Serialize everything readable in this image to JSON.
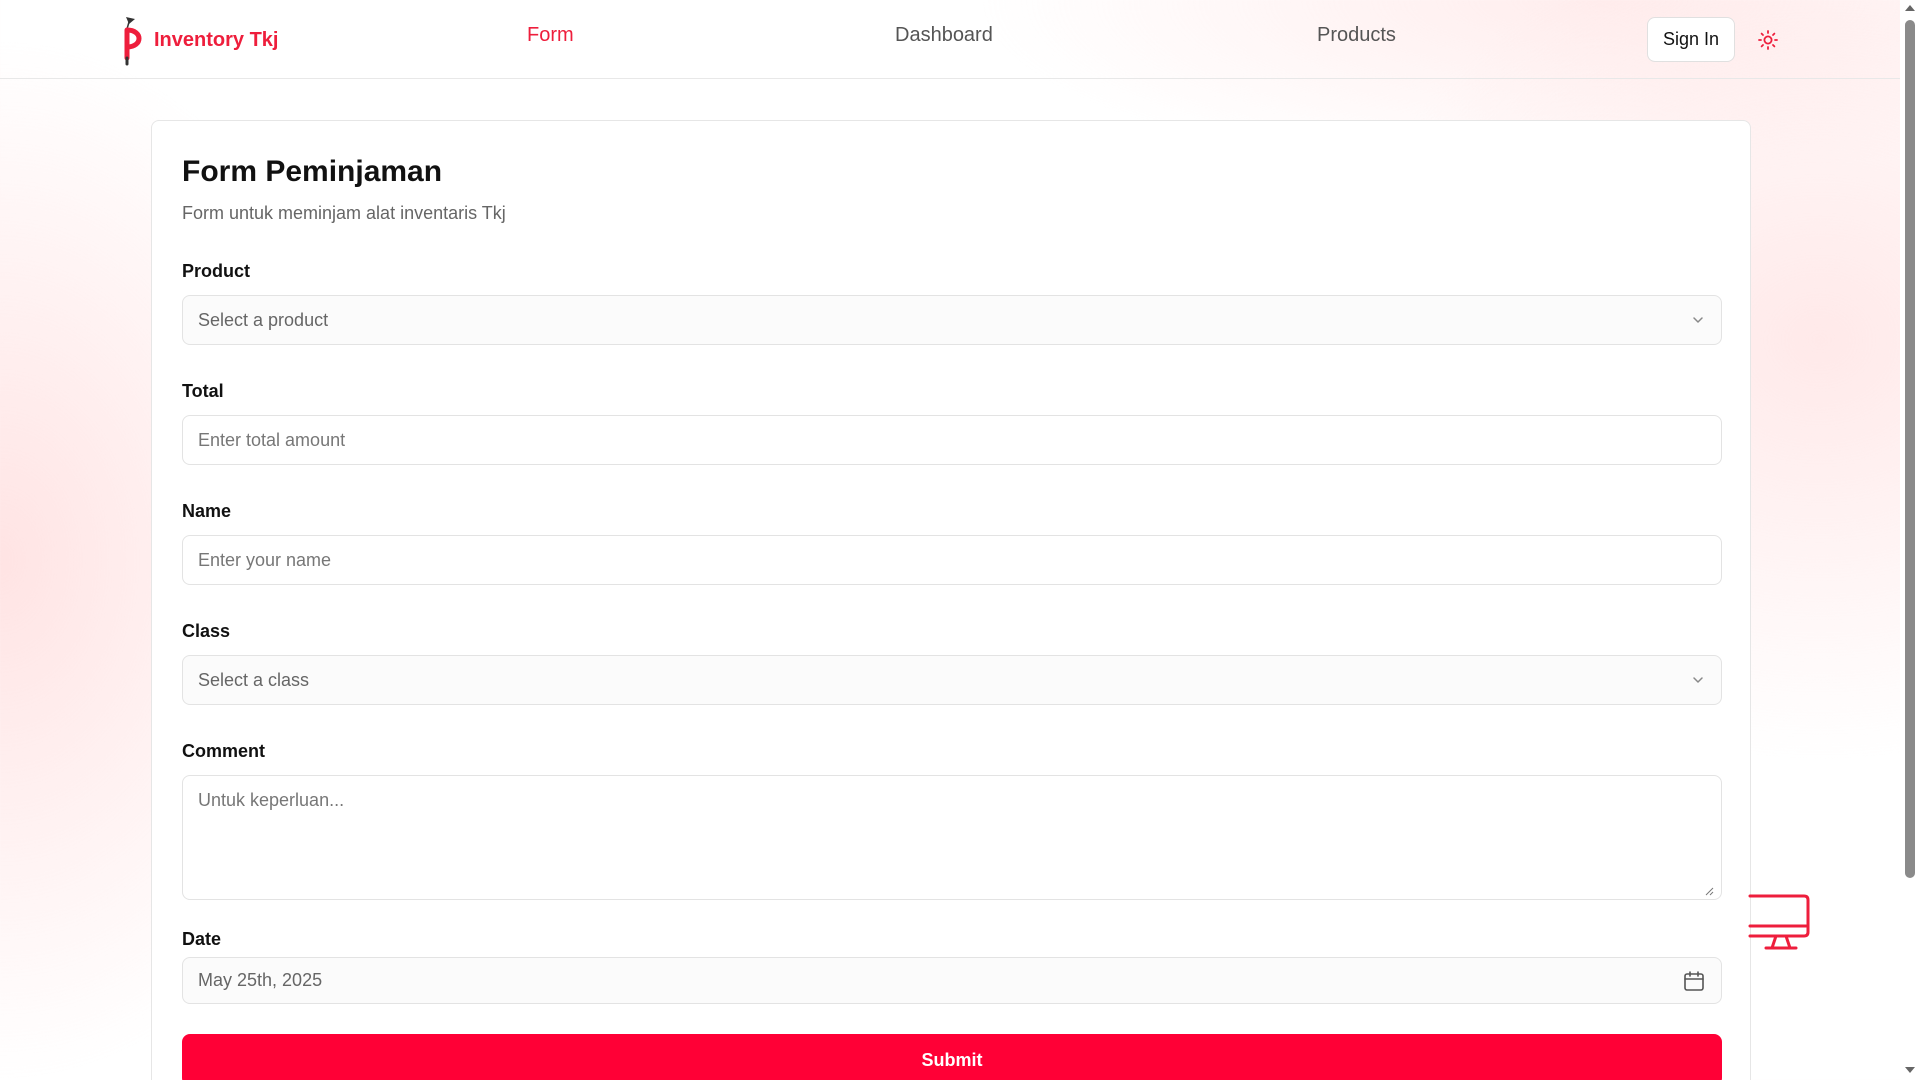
{
  "header": {
    "brand_name": "Inventory Tkj",
    "nav": [
      {
        "label": "Form",
        "active": true
      },
      {
        "label": "Dashboard",
        "active": false
      },
      {
        "label": "Products",
        "active": false
      }
    ],
    "signin_label": "Sign In",
    "theme_icon": "sun-icon"
  },
  "form": {
    "title": "Form Peminjaman",
    "description": "Form untuk meminjam alat inventaris Tkj",
    "product": {
      "label": "Product",
      "placeholder": "Select a product"
    },
    "total": {
      "label": "Total",
      "placeholder": "Enter total amount"
    },
    "name": {
      "label": "Name",
      "placeholder": "Enter your name"
    },
    "class": {
      "label": "Class",
      "placeholder": "Select a class"
    },
    "comment": {
      "label": "Comment",
      "placeholder": "Untuk keperluan..."
    },
    "date": {
      "label": "Date",
      "value": "May 25th, 2025"
    },
    "submit_label": "Submit"
  },
  "colors": {
    "accent": "#ee1e3c",
    "submit": "#ff0036"
  }
}
